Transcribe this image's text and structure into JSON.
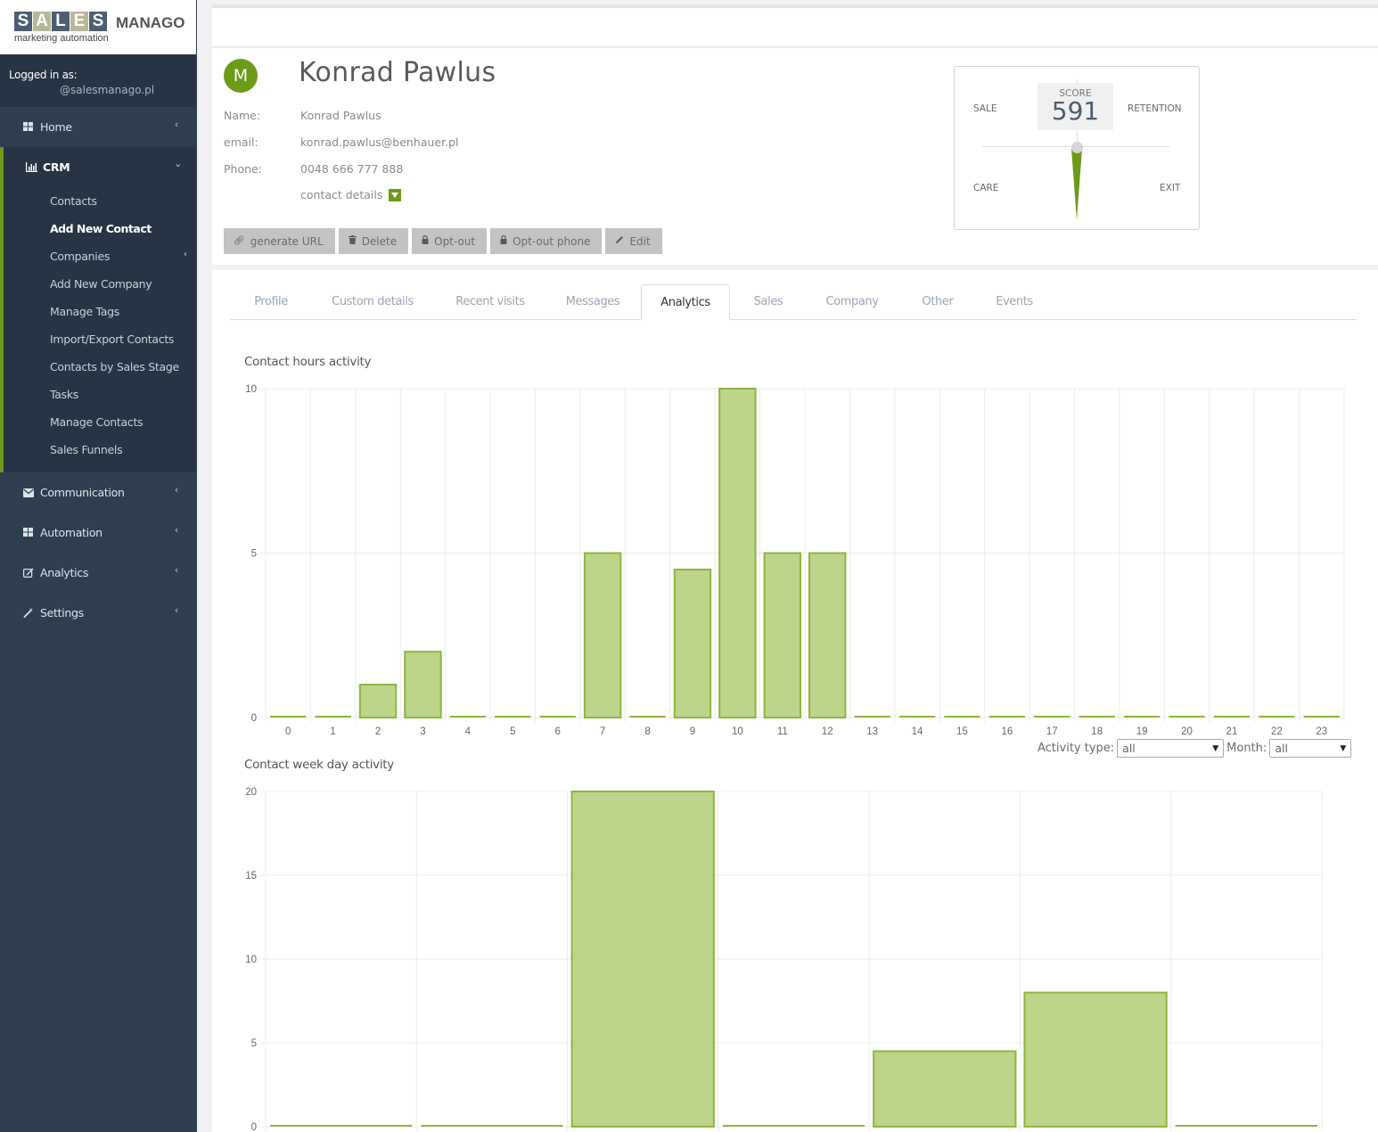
{
  "brand": {
    "letters": [
      "S",
      "A",
      "L",
      "E",
      "S"
    ],
    "name": "MANAGO",
    "tagline": "marketing automation"
  },
  "user": {
    "logged_label": "Logged in as:",
    "email": "@salesmanago.pl"
  },
  "sidebar": {
    "home": "Home",
    "crm": "CRM",
    "crm_items": [
      {
        "label": "Contacts",
        "active": false
      },
      {
        "label": "Add New Contact",
        "active": true
      },
      {
        "label": "Companies",
        "active": false,
        "has_submenu": true
      },
      {
        "label": "Add New Company",
        "active": false
      },
      {
        "label": "Manage Tags",
        "active": false
      },
      {
        "label": "Import/Export Contacts",
        "active": false
      },
      {
        "label": "Contacts by Sales Stage",
        "active": false
      },
      {
        "label": "Tasks",
        "active": false
      },
      {
        "label": "Manage Contacts",
        "active": false
      },
      {
        "label": "Sales Funnels",
        "active": false
      }
    ],
    "sections": [
      {
        "label": "Communication",
        "icon": "envelope-icon"
      },
      {
        "label": "Automation",
        "icon": "grid-icon"
      },
      {
        "label": "Analytics",
        "icon": "edit-icon"
      },
      {
        "label": "Settings",
        "icon": "wand-icon"
      }
    ],
    "accent_color": "#6e9a1a"
  },
  "contact": {
    "avatar_letter": "M",
    "full_name": "Konrad Pawlus",
    "fields": [
      {
        "label": "Name:",
        "value": "Konrad Pawlus"
      },
      {
        "label": "email:",
        "value": "konrad.pawlus@benhauer.pl"
      },
      {
        "label": "Phone:",
        "value": "0048 666 777 888"
      }
    ],
    "details_toggle": "contact details",
    "actions": [
      {
        "label": "generate URL",
        "icon": "link-icon"
      },
      {
        "label": "Delete",
        "icon": "trash-icon"
      },
      {
        "label": "Opt-out",
        "icon": "lock-icon"
      },
      {
        "label": "Opt-out phone",
        "icon": "lock-icon"
      },
      {
        "label": "Edit",
        "icon": "pencil-icon"
      }
    ]
  },
  "score": {
    "label": "SCORE",
    "value": "591",
    "quadrants": {
      "top_left": "SALE",
      "top_right": "RETENTION",
      "bottom_left": "CARE",
      "bottom_right": "EXIT"
    }
  },
  "tabs": [
    {
      "label": "Profile",
      "active": false
    },
    {
      "label": "Custom details",
      "active": false
    },
    {
      "label": "Recent visits",
      "active": false
    },
    {
      "label": "Messages",
      "active": false
    },
    {
      "label": "Analytics",
      "active": true
    },
    {
      "label": "Sales",
      "active": false
    },
    {
      "label": "Company",
      "active": false
    },
    {
      "label": "Other",
      "active": false
    },
    {
      "label": "Events",
      "active": false
    }
  ],
  "filters": {
    "activity_label": "Activity type:",
    "activity_value": "all",
    "month_label": "Month:",
    "month_value": "all"
  },
  "chart_data": [
    {
      "type": "bar",
      "title": "Contact hours activity",
      "categories": [
        "0",
        "1",
        "2",
        "3",
        "4",
        "5",
        "6",
        "7",
        "8",
        "9",
        "10",
        "11",
        "12",
        "13",
        "14",
        "15",
        "16",
        "17",
        "18",
        "19",
        "20",
        "21",
        "22",
        "23"
      ],
      "values": [
        0,
        0,
        1,
        2,
        0,
        0,
        0,
        5,
        0,
        4.5,
        10,
        5,
        5,
        0,
        0,
        0,
        0,
        0,
        0,
        0,
        0,
        0,
        0,
        0
      ],
      "yticks": [
        0,
        5,
        10
      ],
      "ylim": [
        0,
        10
      ],
      "xlabel": "",
      "ylabel": "",
      "grid": true,
      "fill": "#bdd48b",
      "stroke": "#8db63c"
    },
    {
      "type": "bar",
      "title": "Contact week day activity",
      "categories": [
        "",
        "",
        "",
        "",
        "",
        "",
        ""
      ],
      "values": [
        0,
        0,
        20,
        0,
        4.5,
        8,
        0
      ],
      "yticks": [
        0,
        5,
        10,
        15,
        20
      ],
      "ylim": [
        0,
        20
      ],
      "xlabel": "",
      "ylabel": "",
      "grid": true,
      "fill": "#bdd48b",
      "stroke": "#8db63c"
    }
  ]
}
